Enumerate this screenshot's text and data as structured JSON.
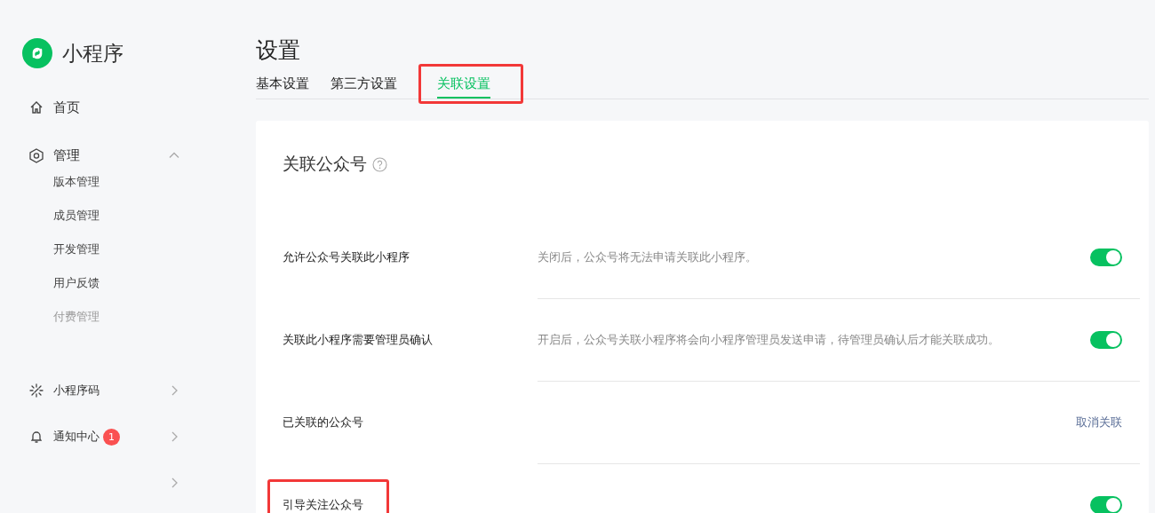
{
  "sidebar": {
    "brand": "小程序",
    "items": [
      {
        "kind": "home",
        "label": "首页"
      },
      {
        "kind": "group",
        "label": "管理",
        "expanded": true,
        "children": [
          {
            "label": "版本管理",
            "faded": false
          },
          {
            "label": "成员管理",
            "faded": false
          },
          {
            "label": "开发管理",
            "faded": false
          },
          {
            "label": "用户反馈",
            "faded": false
          },
          {
            "label": "付费管理",
            "faded": true
          }
        ]
      },
      {
        "kind": "code",
        "label": "小程序码",
        "expanded": false
      },
      {
        "kind": "bell",
        "label": "通知中心",
        "badge": "1",
        "expanded": false
      },
      {
        "kind": "blank",
        "expanded": false
      }
    ]
  },
  "page": {
    "title": "设置",
    "tabs": [
      {
        "label": "基本设置",
        "selected": false,
        "highlighted": false
      },
      {
        "label": "第三方设置",
        "selected": false,
        "highlighted": false
      },
      {
        "label": "关联设置",
        "selected": true,
        "highlighted": true
      }
    ]
  },
  "section": {
    "title": "关联公众号",
    "rows": [
      {
        "kind": "toggle",
        "label": "允许公众号关联此小程序",
        "description": "关闭后，公众号将无法申请关联此小程序。",
        "on": true,
        "highlighted": false
      },
      {
        "kind": "toggle",
        "label": "关联此小程序需要管理员确认",
        "description": "开启后，公众号关联小程序将会向小程序管理员发送申请，待管理员确认后才能关联成功。",
        "on": true,
        "highlighted": false
      },
      {
        "kind": "link",
        "label": "已关联的公众号",
        "link": "取消关联",
        "highlighted": false
      },
      {
        "kind": "toggle",
        "label": "引导关注公众号",
        "on": true,
        "highlighted": true
      }
    ]
  }
}
